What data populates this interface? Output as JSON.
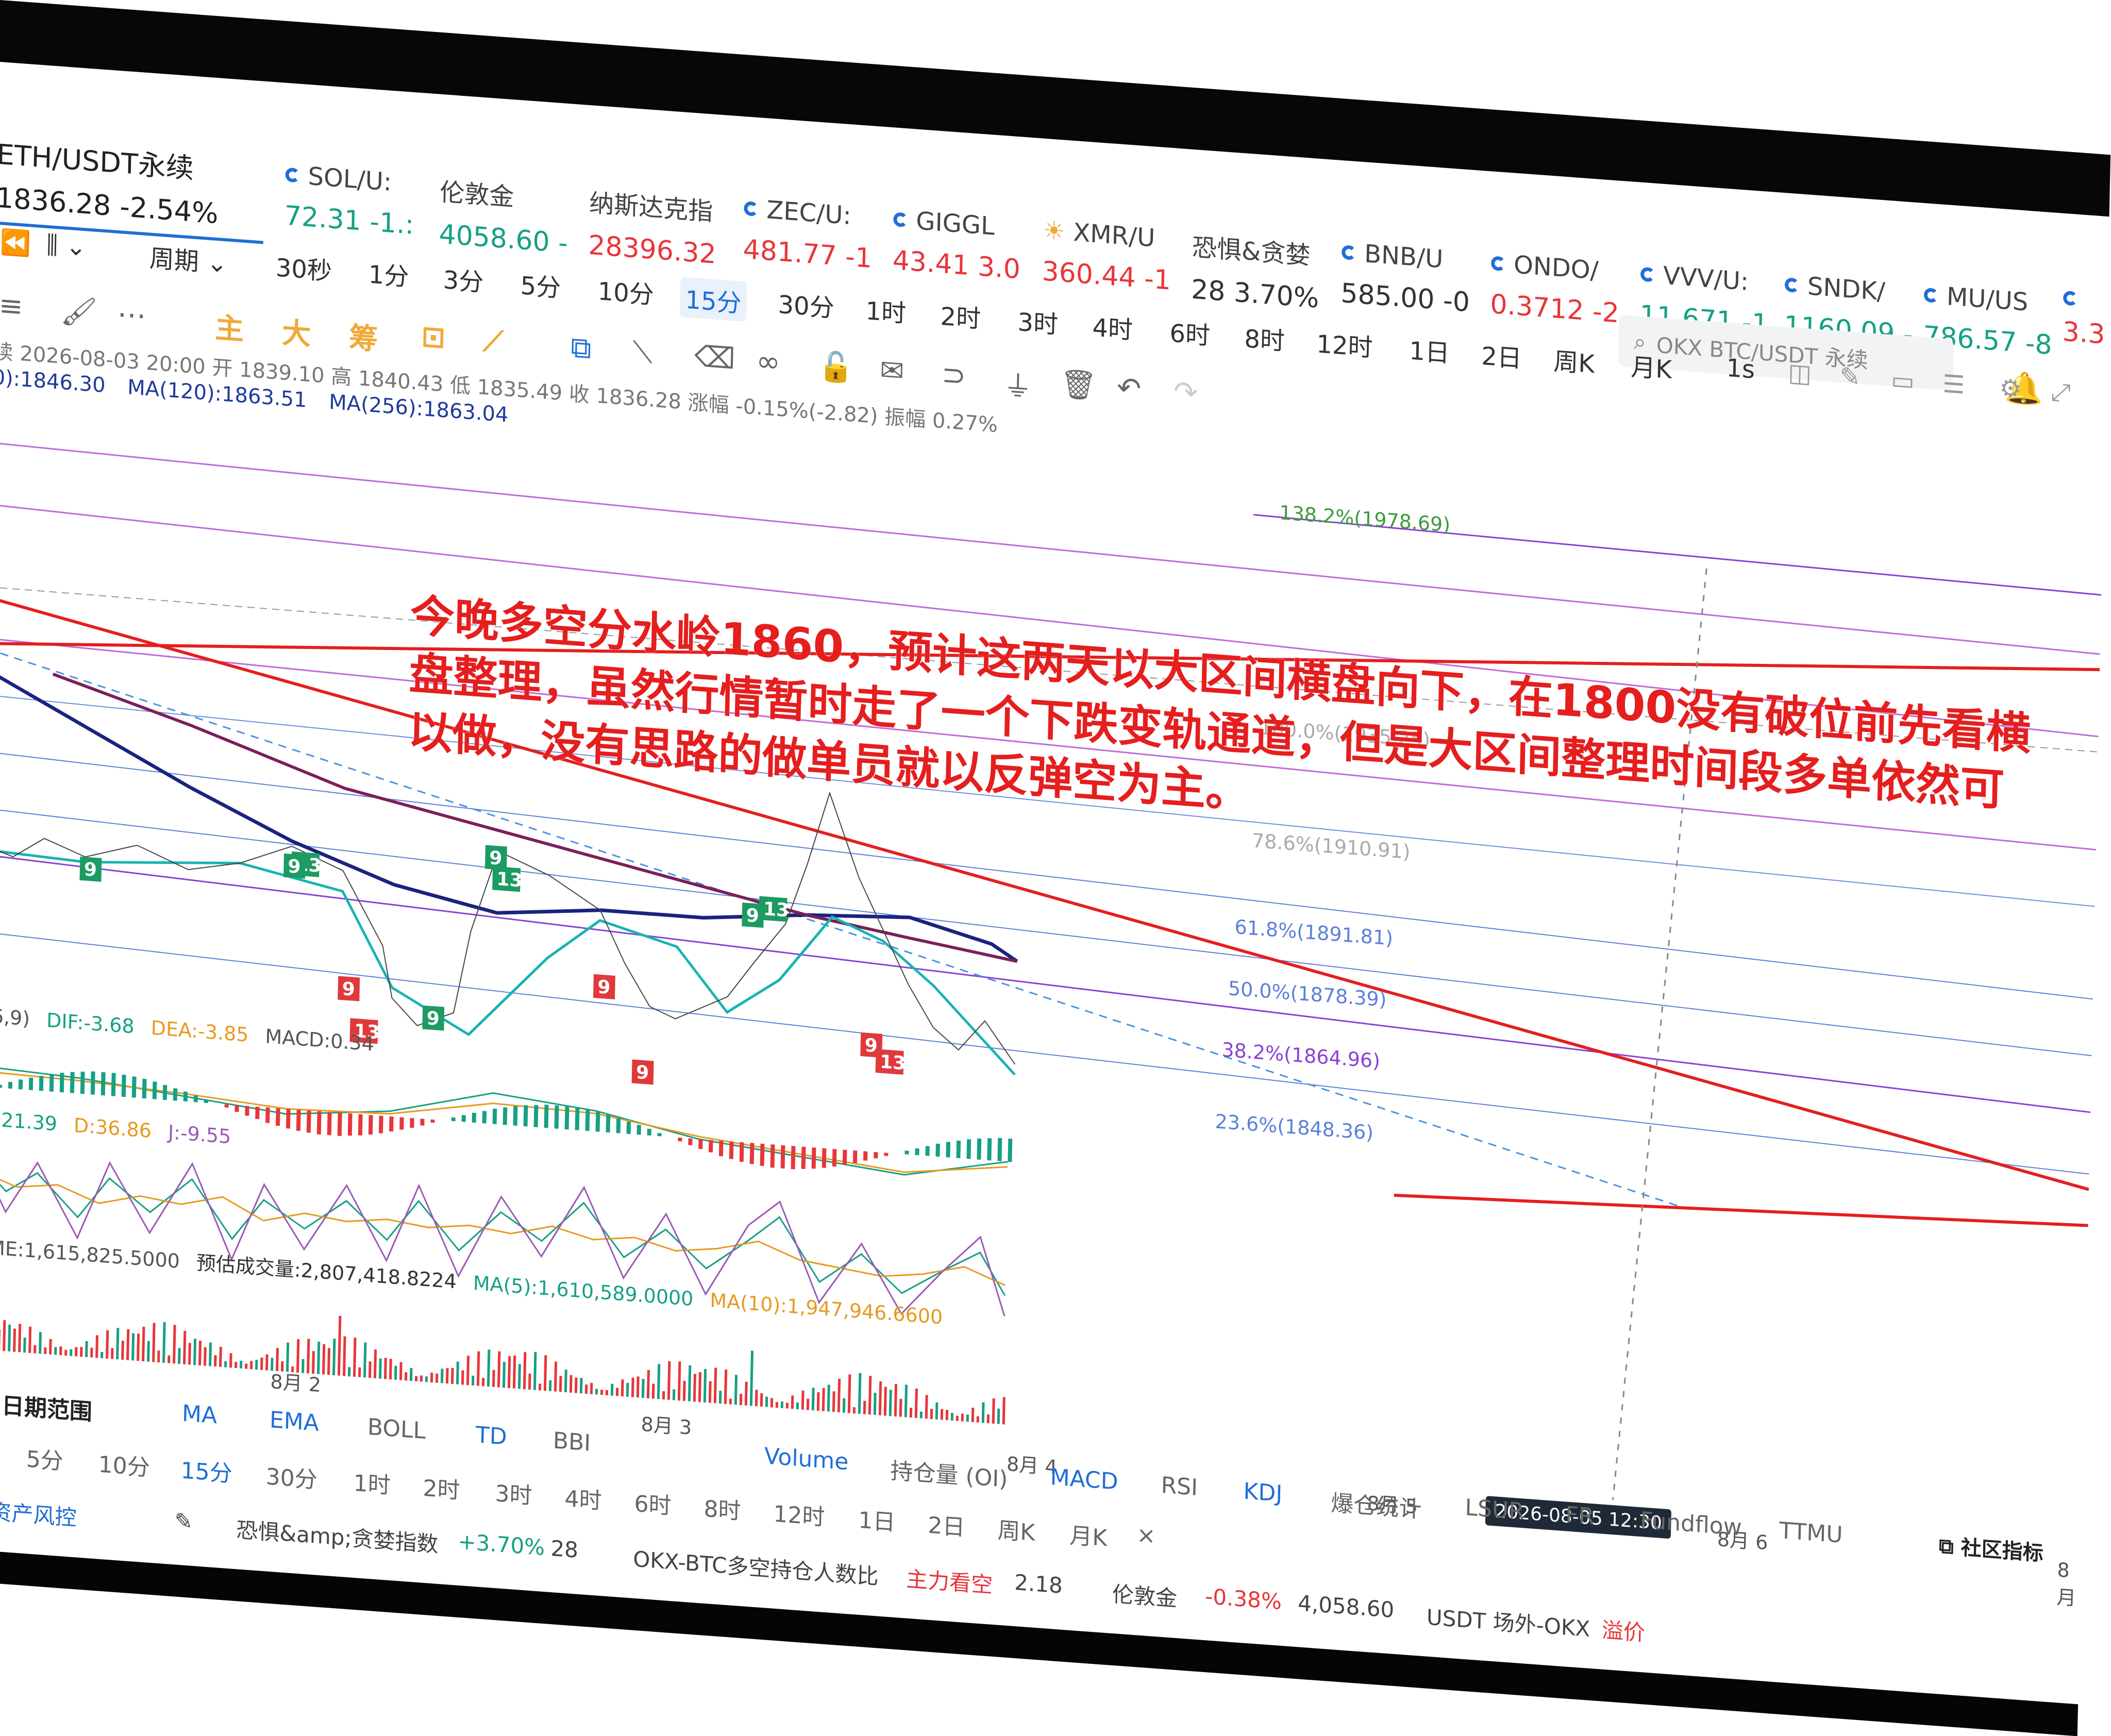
{
  "tickers": [
    {
      "symbol": "ETH/USDT永续",
      "price": "1836.28",
      "change": "-2.54%"
    },
    {
      "symbol": "SOL/U:",
      "price": "72.31",
      "change": "-1.:"
    },
    {
      "symbol": "伦敦金",
      "price": "4058.60",
      "change": "-"
    },
    {
      "symbol": "纳斯达克指",
      "price": "28396.32",
      "change": ""
    },
    {
      "symbol": "ZEC/U:",
      "price": "481.77",
      "change": "-1"
    },
    {
      "symbol": "GIGGL",
      "price": "43.41",
      "change": "3.0"
    },
    {
      "symbol": "XMR/U",
      "price": "360.44",
      "change": "-1"
    },
    {
      "symbol": "恐惧&贪婪",
      "price": "28",
      "change": "3.70%"
    },
    {
      "symbol": "BNB/U",
      "price": "585.00",
      "change": "-0"
    },
    {
      "symbol": "ONDO/",
      "price": "0.3712",
      "change": "-2"
    },
    {
      "symbol": "VVV/U:",
      "price": "11.671",
      "change": "-1"
    },
    {
      "symbol": "SNDK/",
      "price": "1160.09",
      "change": "-"
    },
    {
      "symbol": "MU/US",
      "price": "786.57",
      "change": "-8"
    },
    {
      "symbol": "",
      "price": "3.3",
      "change": ""
    }
  ],
  "search": {
    "placeholder": "OKX BTC/USDT 永续"
  },
  "toolbar": {
    "period_label": "周期",
    "intervals": [
      "30秒",
      "1分",
      "3分",
      "5分",
      "10分",
      "15分",
      "30分",
      "1时",
      "2时",
      "3时",
      "4时",
      "6时",
      "8时",
      "12时",
      "1日",
      "2日",
      "周K",
      "月K"
    ],
    "active_interval": "15分",
    "right_icon": "1s"
  },
  "draw_tools": {
    "labels": [
      "主",
      "大",
      "筹"
    ]
  },
  "candle_info": "续 2026-08-03 20:00 开 1839.10 高 1840.43 低 1835.49 收 1836.28 涨幅 -0.15%(-2.82) 振幅 0.27%",
  "ma_info": {
    "ma_a": "0):1846.30",
    "ma120": "MA(120):1863.51",
    "ma256": "MA(256):1863.04"
  },
  "fib_levels": [
    {
      "label": "138.2%(1978.69)"
    },
    {
      "label": "100.0%(1935.25)"
    },
    {
      "label": "78.6%(1910.91)"
    },
    {
      "label": "61.8%(1891.81)"
    },
    {
      "label": "50.0%(1878.39)"
    },
    {
      "label": "38.2%(1864.96)"
    },
    {
      "label": "23.6%(1848.36)"
    }
  ],
  "annotation": "今晚多空分水岭1860，预计这两天以大区间横盘向下，在1800没有破位前先看横盘整理，虽然行情暂时走了一个下跌变轨通道，但是大区间整理时间段多单依然可以做，没有思路的做单员就以反弹空为主。",
  "td_marks": [
    {
      "text": "9",
      "color": "#1c9b62"
    },
    {
      "text": "13",
      "color": "#1c9b62"
    },
    {
      "text": "9",
      "color": "#1c9b62"
    },
    {
      "text": "9",
      "color": "#1c9b62"
    },
    {
      "text": "13",
      "color": "#1c9b62"
    },
    {
      "text": "9",
      "color": "#1c9b62"
    },
    {
      "text": "13",
      "color": "#1c9b62"
    },
    {
      "text": "9",
      "color": "#1c9b62"
    },
    {
      "text": "9",
      "color": "#e0393b"
    },
    {
      "text": "13",
      "color": "#e0393b"
    },
    {
      "text": "9",
      "color": "#e0393b"
    },
    {
      "text": "9",
      "color": "#e0393b"
    },
    {
      "text": "9",
      "color": "#e0393b"
    },
    {
      "text": "13",
      "color": "#e0393b"
    }
  ],
  "macd": {
    "prefix": "26,9)",
    "dif": "DIF:-3.68",
    "dea": "DEA:-3.85",
    "macd": "MACD:0.34"
  },
  "kdj": {
    "k": "K:21.39",
    "d": "D:36.86",
    "j": "J:-9.55"
  },
  "volume": {
    "vol": "UME:1,615,825.5000",
    "est": "预估成交量:2,807,418.8224",
    "ma5": "MA(5):1,610,589.0000",
    "ma10": "MA(10):1,947,946.6600"
  },
  "dates": [
    "8月 2",
    "8月 3",
    "8月 4",
    "8月 5",
    "8月 6",
    "8月"
  ],
  "date_badge": "2026-08-05 12:30",
  "bottom_tabs": {
    "date_range": "日期范围",
    "main_indicators": [
      "MA",
      "EMA",
      "BOLL",
      "TD",
      "BBI"
    ],
    "sub_indicators": [
      "Volume",
      "持仓量 (OI)",
      "MACD",
      "RSI",
      "KDJ",
      "爆仓统计",
      "LSUR",
      "FR",
      "Fundflow",
      "TTMU"
    ],
    "community": "社区指标"
  },
  "bottom_intervals": [
    "分",
    "5分",
    "10分",
    "15分",
    "30分",
    "1时",
    "2时",
    "3时",
    "4时",
    "6时",
    "8时",
    "12时",
    "1日",
    "2日",
    "周K",
    "月K",
    "×"
  ],
  "status": {
    "risk": "时资产风控",
    "fear_label": "恐惧&amp;贪婪指数",
    "fear_change": "+3.70%",
    "fear_value": "28",
    "ratio_label": "OKX-BTC多空持仓人数比",
    "ratio_tag": "主力看空",
    "ratio_value": "2.18",
    "gold_label": "伦敦金",
    "gold_change": "-0.38%",
    "gold_value": "4,058.60",
    "usdt_label": "USDT 场外-OKX",
    "usdt_tag": "溢价"
  },
  "colors": {
    "up": "#16a085",
    "down": "#e8363a",
    "accent": "#1f6fd6",
    "fib": "#8a42d6",
    "annotation": "#e51e1e"
  }
}
